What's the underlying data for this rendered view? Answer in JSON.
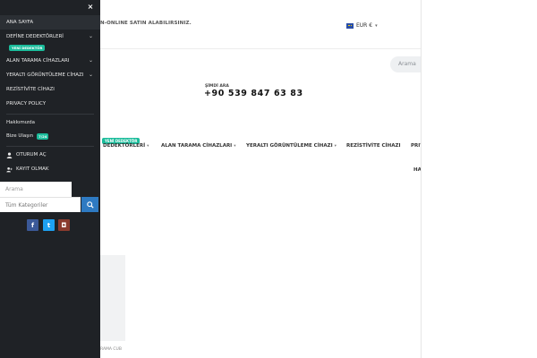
{
  "drawer": {
    "close_glyph": "×",
    "menu": [
      {
        "label": "ANA SAYFA"
      },
      {
        "label": "DEFİNE DEDEKTÖRLERİ",
        "badge": "YENİ DEDEKTÖR"
      },
      {
        "label": "ALAN TARAMA CİHAZLARI"
      },
      {
        "label": "YERALTI GÖRÜNTÜLEME CİHAZI"
      },
      {
        "label": "REZİSTİVİTE CİHAZI"
      },
      {
        "label": "PRIVACY POLICY"
      }
    ],
    "about_label": "Hakkımızda",
    "contact_label": "Bize Ulaşın",
    "contact_badge": "7/24",
    "login_label": "OTURUM AÇ",
    "register_label": "KAYIT OLMAK",
    "search_placeholder": "Arama",
    "category_select": "Tüm Kategoriler",
    "social": {
      "facebook": "f",
      "twitter": "t",
      "instagram": "◘"
    }
  },
  "page": {
    "promo_text": "N-ONLINE SATIN ALABILIRSINIZ.",
    "currency": "EUR €",
    "search_placeholder": "Arama",
    "call_label": "ŞİMDİ ARA",
    "phone": "+90 539 847 63 83",
    "nav": [
      {
        "label": "DEDEKTÖRLERİ",
        "badge": "YENİ DEDEKTÖR"
      },
      {
        "label": "ALAN TARAMA CİHAZLARI"
      },
      {
        "label": "YERALTI GÖRÜNTÜLEME CİHAZI"
      },
      {
        "label": "REZİSTİVİTE CİHAZI"
      },
      {
        "label": "PRIV"
      }
    ],
    "nav_extra": "HA",
    "caption": "RAMA CUB"
  },
  "colors": {
    "drawer_bg": "#1f2226",
    "accent_green": "#1bbc9b",
    "search_button": "#2e7ac2"
  }
}
